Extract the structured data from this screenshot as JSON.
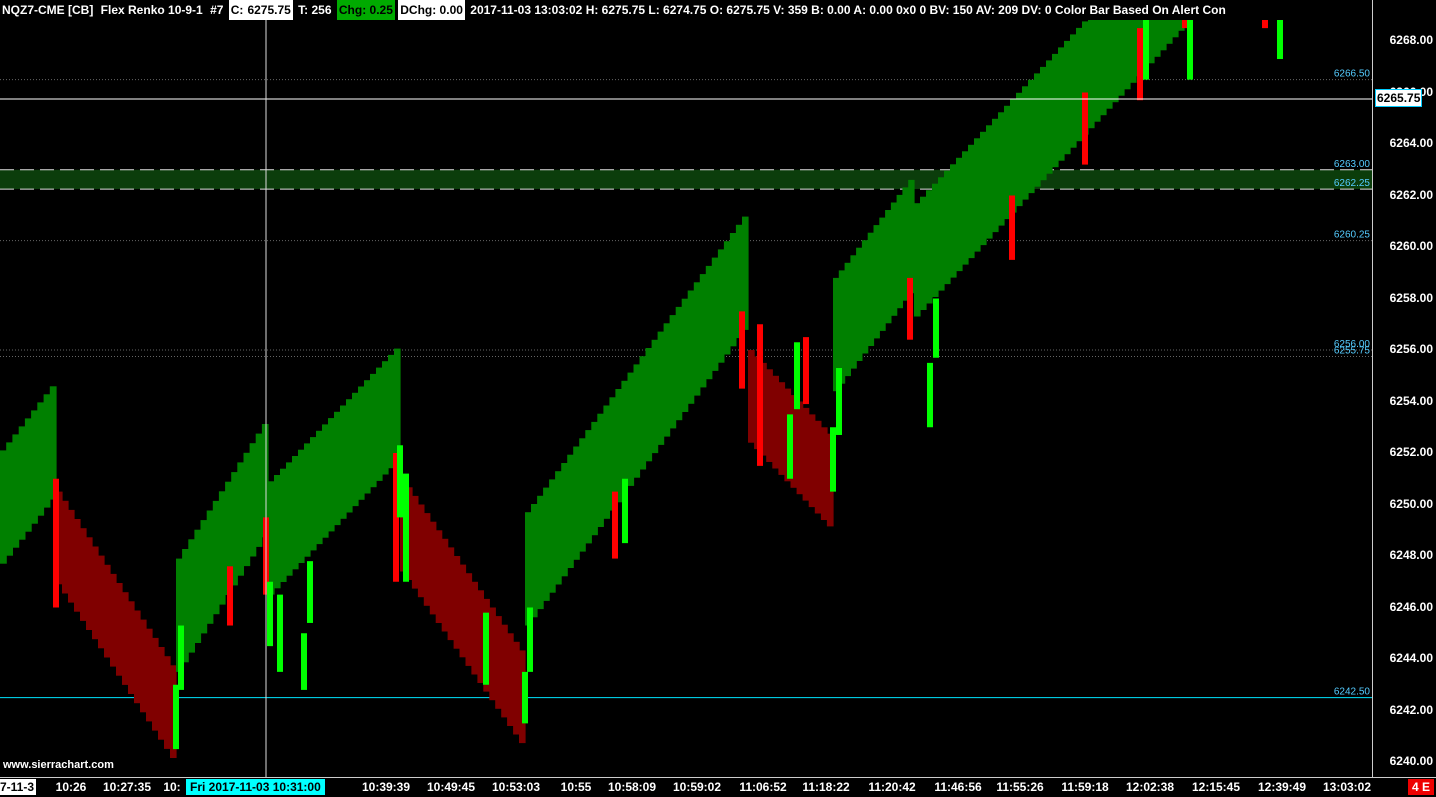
{
  "header": {
    "symbol": "NQZ7-CME [CB]",
    "chart_type": "Flex Renko 10-9-1",
    "chart_number": "#7",
    "close_label": "C:",
    "close_value": "6275.75",
    "ticks": "T: 256",
    "chg": "Chg: 0.25",
    "dchg": "DChg: 0.00",
    "rest": "2017-11-03 13:03:02 H: 6275.75 L: 6274.75 O: 6275.75 V: 359 B: 0.00 A: 0.00 0x0 0 BV: 150 AV: 209 DV: 0 Color Bar Based On Alert Con"
  },
  "last_price": "6265.75",
  "cursor_time": "Fri 2017-11-03  10:31:00",
  "date_left": "7-11-3",
  "badge": "4 E",
  "watermark": "www.sierrachart.com",
  "colors": {
    "up": "#008000",
    "down": "#800000",
    "up_wick": "#00ff00",
    "down_wick": "#ff0000",
    "cursor": "#00ffff"
  },
  "chart_data": {
    "type": "renko",
    "ylim": [
      6239.5,
      6269.5
    ],
    "y_ticks": [
      6240,
      6242,
      6244,
      6246,
      6248,
      6250,
      6252,
      6254,
      6256,
      6258,
      6260,
      6262,
      6264,
      6266,
      6268
    ],
    "x_tick_labels": [
      "10:26",
      "10:27:35",
      "10:",
      "10:39:39",
      "10:49:45",
      "10:53:03",
      "10:55",
      "10:58:09",
      "10:59:02",
      "11:06:52",
      "11:18:22",
      "11:20:42",
      "11:46:56",
      "11:55:26",
      "11:59:18",
      "12:02:38",
      "12:15:45",
      "12:39:49",
      "13:03:02"
    ],
    "levels": [
      {
        "label": "6266.50",
        "value": 6266.5,
        "style": "dotted",
        "color": "#4a4a4a"
      },
      {
        "label": "6263.00",
        "value": 6263.0,
        "style": "dashed-band",
        "color": "#0a4a0a"
      },
      {
        "label": "6262.25",
        "value": 6262.25,
        "style": "dashed-band",
        "color": "#0a4a0a"
      },
      {
        "label": "6260.25",
        "value": 6260.25,
        "style": "dotted",
        "color": "#4a4a4a"
      },
      {
        "label": "6256.00",
        "value": 6256.0,
        "style": "dotted",
        "color": "#4a4a4a"
      },
      {
        "label": "6255.75",
        "value": 6255.75,
        "style": "dotted",
        "color": "#4a4a4a"
      },
      {
        "label": "6242.50",
        "value": 6242.5,
        "style": "solid",
        "color": "#00e5ff"
      }
    ],
    "price_line": 6265.75,
    "path": [
      6248.0,
      6250.75,
      6246.3,
      6240.75,
      6243.0,
      6248.5,
      6244.0,
      6243.0,
      6252.0,
      6247.0,
      6241.75,
      6248.5,
      6256.9,
      6251.3,
      6250.75,
      6255.5,
      6258.5,
      6254.0,
      6256.0,
      6269.5,
      6269.5,
      6267.5
    ],
    "renko_bands": [
      {
        "dir": "up",
        "start": 6247.7,
        "end": 6250.5
      },
      {
        "dir": "down",
        "start": 6249.5,
        "end": 6242.4
      },
      {
        "dir": "up",
        "start": 6243.5,
        "end": 6249.1
      },
      {
        "dir": "up",
        "start": 6246.5,
        "end": 6251.9
      },
      {
        "dir": "down",
        "start": 6250.0,
        "end": 6243.0
      },
      {
        "dir": "up",
        "start": 6245.3,
        "end": 6257.1
      },
      {
        "dir": "down",
        "start": 6255.0,
        "end": 6251.5
      },
      {
        "dir": "up",
        "start": 6254.4,
        "end": 6258.5
      },
      {
        "dir": "up",
        "start": 6257.3,
        "end": 6268.9
      }
    ]
  }
}
